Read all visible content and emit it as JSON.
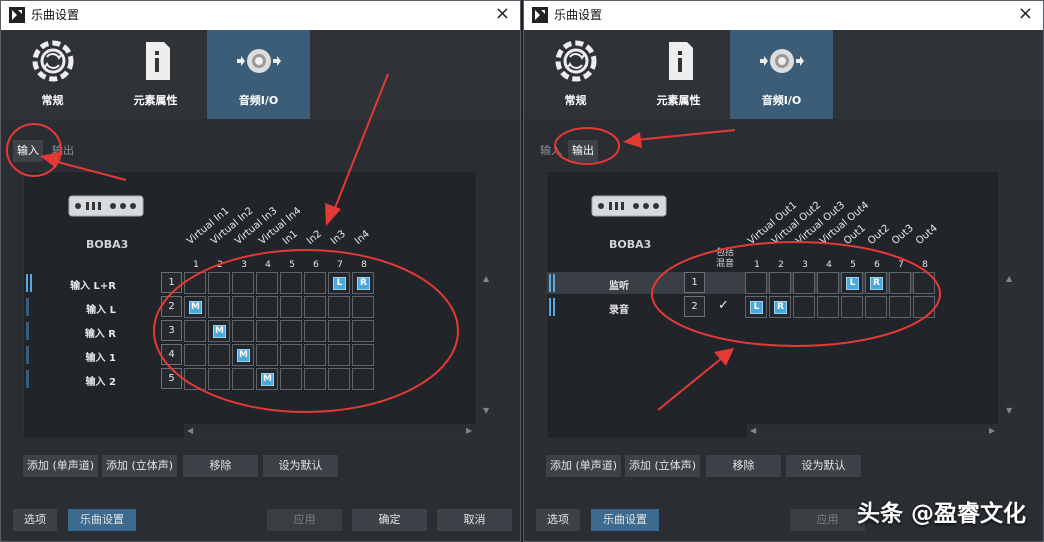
{
  "left": {
    "title": "乐曲设置",
    "close": "×",
    "categories": [
      "常规",
      "元素属性",
      "音频I/O"
    ],
    "subtabs": [
      "输入",
      "输出"
    ],
    "device_name": "BOBA3",
    "channels": {
      "numbers": [
        "1",
        "2",
        "3",
        "4",
        "5",
        "6",
        "7",
        "8"
      ],
      "labels": [
        "Virtual In1",
        "Virtual In2",
        "Virtual In3",
        "Virtual In4",
        "In1",
        "In2",
        "In3",
        "In4"
      ]
    },
    "rows": [
      {
        "label": "输入 L+R",
        "num": "1"
      },
      {
        "label": "输入 L",
        "num": "2"
      },
      {
        "label": "输入 R",
        "num": "3"
      },
      {
        "label": "输入 1",
        "num": "4"
      },
      {
        "label": "输入 2",
        "num": "5"
      }
    ],
    "marks": {
      "L": "L",
      "R": "R",
      "M": "M"
    },
    "buttons": [
      "添加 (单声道)",
      "添加 (立体声)",
      "移除",
      "设为默认"
    ],
    "footer": [
      "选项",
      "乐曲设置",
      "应用",
      "确定",
      "取消"
    ]
  },
  "right": {
    "title": "乐曲设置",
    "close": "×",
    "categories": [
      "常规",
      "元素属性",
      "音频I/O"
    ],
    "subtabs": [
      "输入",
      "输出"
    ],
    "device_name": "BOBA3",
    "include_label": "包括\n混音",
    "channels": {
      "numbers": [
        "1",
        "2",
        "3",
        "4",
        "5",
        "6",
        "7",
        "8"
      ],
      "labels": [
        "Virtual Out1",
        "Virtual Out2",
        "Virtual Out3",
        "Virtual Out4",
        "Out1",
        "Out2",
        "Out3",
        "Out4"
      ]
    },
    "rows": [
      {
        "label": "监听",
        "num": "1"
      },
      {
        "label": "录音",
        "num": "2"
      }
    ],
    "check": "✓",
    "marks": {
      "L": "L",
      "R": "R"
    },
    "buttons": [
      "添加 (单声道)",
      "添加 (立体声)",
      "移除",
      "设为默认"
    ],
    "footer": [
      "选项",
      "乐曲设置",
      "应用"
    ]
  },
  "watermark": "头条 @盈睿文化",
  "colors": {
    "accent": "#3c5d78",
    "mark": "#4aa8de",
    "annotation": "#e53935"
  }
}
